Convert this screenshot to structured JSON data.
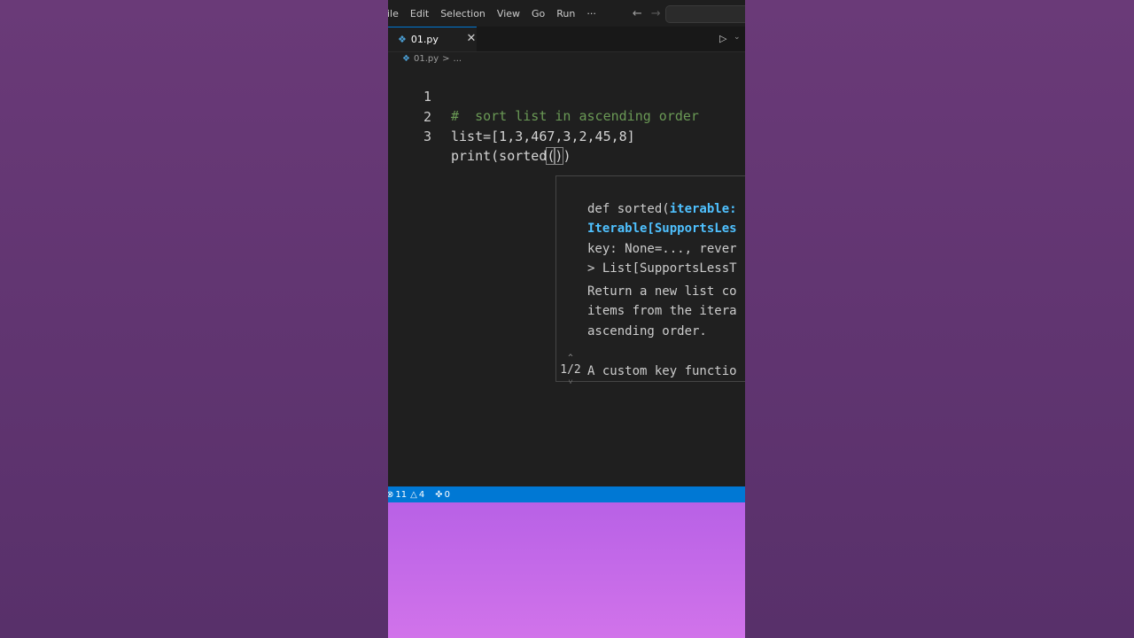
{
  "menu": {
    "items": [
      "ile",
      "Edit",
      "Selection",
      "View",
      "Go",
      "Run"
    ],
    "more_label": "···",
    "back_arrow": "←",
    "forward_arrow": "→"
  },
  "tab": {
    "filename": "01.py",
    "close_glyph": "✕",
    "run_glyph": "▷",
    "run_menu_glyph": "⌵"
  },
  "breadcrumb": {
    "file": "01.py",
    "separator": ">",
    "more": "..."
  },
  "editor": {
    "lines": [
      {
        "number": "1",
        "text": "#  sort list in ascending order"
      },
      {
        "number": "2",
        "text": "list=[1,3,467,3,2,45,8]"
      },
      {
        "number": "3",
        "prefix": "print(sorted",
        "open_paren": "(",
        "close_paren": ")",
        "suffix": ")"
      }
    ]
  },
  "signature_help": {
    "line1_prefix": "def sorted(",
    "line1_param": "iterable:",
    "line2": "Iterable[SupportsLes",
    "line3": "key: None=..., rever",
    "line4": "> List[SupportsLessT",
    "doc1": "Return a new list co",
    "doc2": "items from the itera",
    "doc3": "ascending order.",
    "doc4": "A custom key functio",
    "overload_counter": "1/2",
    "up_arrow": "^",
    "down_arrow": "˅"
  },
  "status": {
    "errors": "11",
    "warnings": "4",
    "ports": "0"
  },
  "colors": {
    "background": "#603470",
    "editor_bg": "#1f1f1f",
    "status_bar": "#0078d4",
    "comment": "#6a9955",
    "type_blue": "#4fc1ff"
  }
}
